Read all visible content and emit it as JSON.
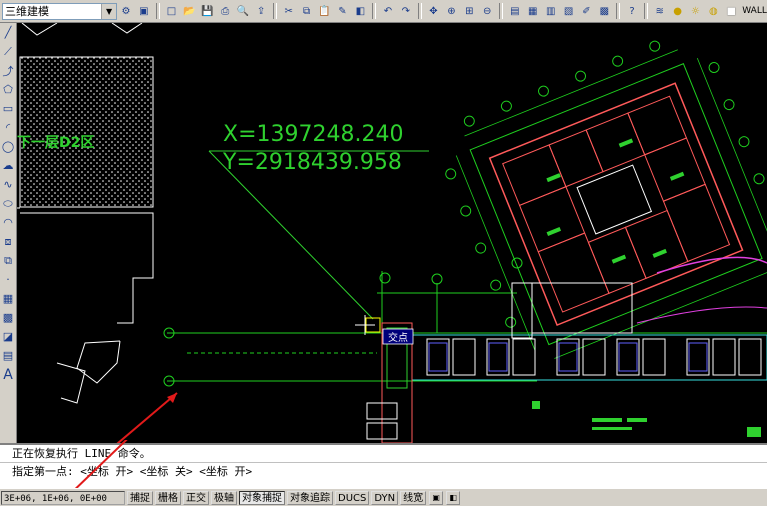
{
  "toolbar": {
    "workspace": "三维建模",
    "wall_label": "WALL",
    "icons": [
      "new-icon",
      "open-icon",
      "save-icon",
      "print-icon",
      "preview-icon",
      "publish-icon",
      "cut-icon",
      "copy-icon",
      "paste-icon",
      "match-properties-icon",
      "block-editor-icon",
      "undo-icon",
      "redo-icon",
      "pan-icon",
      "zoom-realtime-icon",
      "zoom-window-icon",
      "zoom-previous-icon",
      "properties-icon",
      "design-center-icon",
      "tool-palettes-icon",
      "sheet-set-icon",
      "markup-icon",
      "calculator-icon",
      "help-icon",
      "layer-manager-icon",
      "lightbulb-icon",
      "sun-icon",
      "lock-icon",
      "color-square-icon"
    ]
  },
  "left_tools": [
    "line-icon",
    "construction-line-icon",
    "polyline-icon",
    "polygon-icon",
    "rectangle-icon",
    "arc-icon",
    "circle-icon",
    "revision-cloud-icon",
    "spline-icon",
    "ellipse-icon",
    "ellipse-arc-icon",
    "insert-block-icon",
    "make-block-icon",
    "point-icon",
    "hatch-icon",
    "gradient-icon",
    "region-icon",
    "table-icon",
    "multiline-text-icon"
  ],
  "drawing": {
    "zone_label": "下一层D2区",
    "coord_x": "X=1397248.240",
    "coord_y": "Y=2918439.958",
    "intersection_label": "交点"
  },
  "command_line": {
    "line1": "正在恢复执行 LINE 命令。",
    "line2": "指定第一点: <坐标 开> <坐标 关> <坐标 开>"
  },
  "status_bar": {
    "coords": "3E+06, 1E+06, 0E+00",
    "buttons": [
      {
        "label": "捕捉",
        "on": false
      },
      {
        "label": "栅格",
        "on": false
      },
      {
        "label": "正交",
        "on": false
      },
      {
        "label": "极轴",
        "on": false
      },
      {
        "label": "对象捕捉",
        "on": true
      },
      {
        "label": "对象追踪",
        "on": false
      },
      {
        "label": "DUCS",
        "on": false
      },
      {
        "label": "DYN",
        "on": false
      },
      {
        "label": "线宽",
        "on": false
      }
    ]
  },
  "colors": {
    "canvas_bg": "#000000",
    "coord_text": "#2fd12f",
    "grid_green": "#1fcf1f",
    "wall_red": "#ff5a5a",
    "arrow_red": "#e11a1a",
    "magenta": "#e040e0",
    "cyan": "#38e0e0"
  }
}
